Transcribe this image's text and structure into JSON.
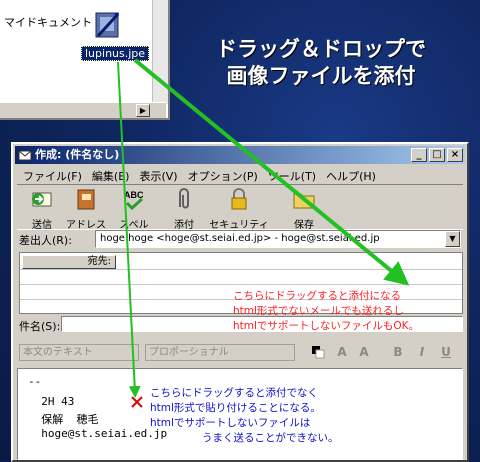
{
  "explorer": {
    "folder_label": "マイドキュメント",
    "file_name": "lupinus.jpe",
    "scroll_arrow": "▶"
  },
  "headline": {
    "line1": "ドラッグ＆ドロップで",
    "line2": "画像ファイルを添付"
  },
  "window": {
    "title": "作成: (件名なし)",
    "controls": [
      "_",
      "□",
      "×"
    ],
    "menu": [
      "ファイル(F)",
      "編集(E)",
      "表示(V)",
      "オプション(P)",
      "ツール(T)",
      "ヘルプ(H)"
    ],
    "toolbar": [
      {
        "label": "送信",
        "icon": "send-icon"
      },
      {
        "label": "アドレス",
        "icon": "address-book-icon"
      },
      {
        "label": "スペル",
        "icon": "spell-check-icon"
      },
      {
        "label": "添付",
        "icon": "paperclip-icon"
      },
      {
        "label": "セキュリティ",
        "icon": "lock-icon"
      },
      {
        "label": "保存",
        "icon": "folder-icon"
      }
    ],
    "from_label": "差出人(R):",
    "from_value": "hoge hoge <hoge@st.seiai.ed.jp>  - hoge@st.seiai.ed.jp",
    "addr_type": "宛先:",
    "subject_label": "件名(S):",
    "format": {
      "style": "本文のテキスト",
      "font": "プロポーショナル",
      "bold": "B",
      "italic": "I",
      "underline": "U",
      "size": "A"
    },
    "body_lines": [
      "--",
      "  2H 43",
      "  保解  穂毛",
      "  hoge@st.seiai.ed.jp"
    ]
  },
  "notes": {
    "red": [
      "こちらにドラッグすると添付になる",
      "html形式でないメールでも送れるし",
      "htmlでサポートしないファイルもOK。"
    ],
    "blue": [
      "こちらにドラッグすると添付でなく",
      "html形式で貼り付けることになる。",
      "htmlでサポートしないファイルは",
      "うまく送ることができない。"
    ]
  },
  "colors": {
    "arrow": "#22c022",
    "note_red": "#ff2020",
    "note_blue": "#1010d0",
    "titlebar": "#0a246a"
  }
}
